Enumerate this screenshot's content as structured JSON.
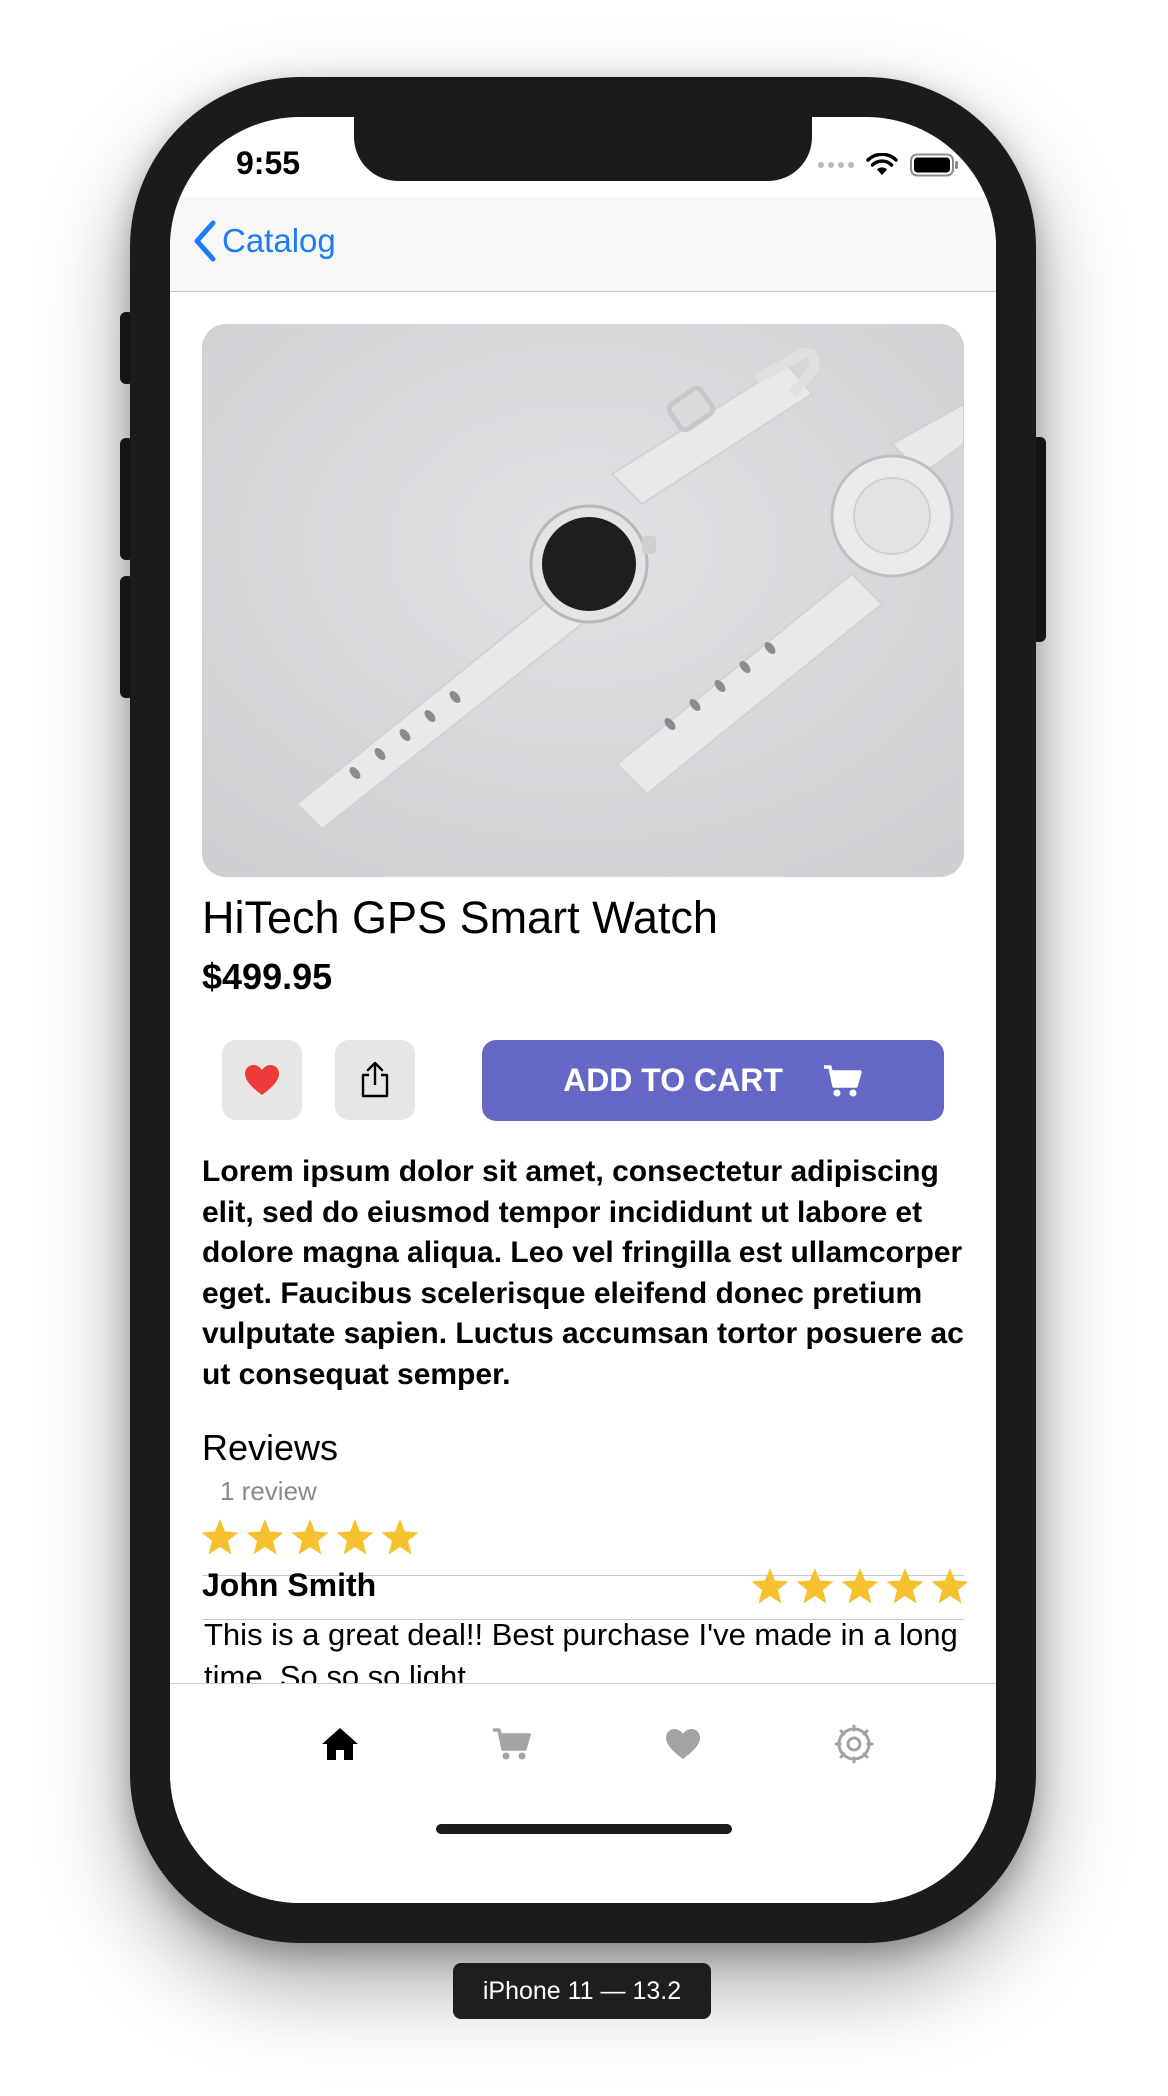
{
  "status_bar": {
    "time": "9:55"
  },
  "nav": {
    "back_label": "Catalog"
  },
  "product": {
    "title": "HiTech GPS Smart Watch",
    "price": "$499.95",
    "add_to_cart_label": "ADD TO CART",
    "description": "Lorem ipsum dolor sit amet, consectetur adipiscing elit, sed do eiusmod tempor incididunt ut labore et dolore magna aliqua. Leo vel fringilla est ullamcorper eget. Faucibus scelerisque eleifend donec pretium vulputate sapien. Luctus accumsan tortor posuere ac ut consequat semper."
  },
  "reviews": {
    "heading": "Reviews",
    "count_label": "1 review",
    "average_rating": 5,
    "items": [
      {
        "author": "John Smith",
        "rating": 5,
        "text": "This is a great deal!! Best purchase I've made in a long time. So so so light..."
      }
    ]
  },
  "tabs": [
    "home",
    "cart",
    "favorites",
    "settings"
  ],
  "colors": {
    "accent": "#1b7cf6",
    "cart_button": "#6467c4",
    "star": "#f6c12f",
    "heart": "#f03a3a"
  },
  "simulator_label": "iPhone 11 — 13.2"
}
